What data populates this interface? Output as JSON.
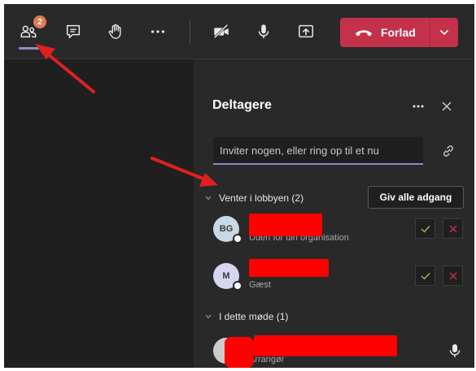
{
  "toolbar": {
    "participants_badge": "2",
    "leave_label": "Forlad",
    "icons": [
      "people-icon",
      "chat-icon",
      "raise-hand-icon",
      "more-icon",
      "camera-off-icon",
      "mic-icon",
      "share-screen-icon",
      "hangup-icon",
      "chevron-down-icon"
    ]
  },
  "panel": {
    "title": "Deltagere",
    "invite_placeholder": "Inviter nogen, eller ring op til et nu",
    "lobby": {
      "header": "Venter i lobbyen (2)",
      "admit_all_label": "Giv alle adgang",
      "people": [
        {
          "initials": "BG",
          "name": "",
          "role": "Uden for din organisation",
          "avatar_color": "#c8d8e4",
          "redaction_color": "#ff0000"
        },
        {
          "initials": "M",
          "name": "",
          "role": "Gæst",
          "avatar_color": "#d6d6f0",
          "redaction_color": "#ff0000"
        }
      ]
    },
    "in_meeting": {
      "header": "I dette møde (1)",
      "people": [
        {
          "initials": "",
          "name": "",
          "role": "Arrangør",
          "avatar_color": "#cccccc",
          "redaction_color": "#ff0000"
        }
      ]
    }
  },
  "colors": {
    "accent": "#8b8cc7",
    "leave": "#c4314b",
    "badge": "#e17a54",
    "annotation_arrow": "#e02020",
    "accept": "#92c353",
    "deny": "#c4314b"
  }
}
